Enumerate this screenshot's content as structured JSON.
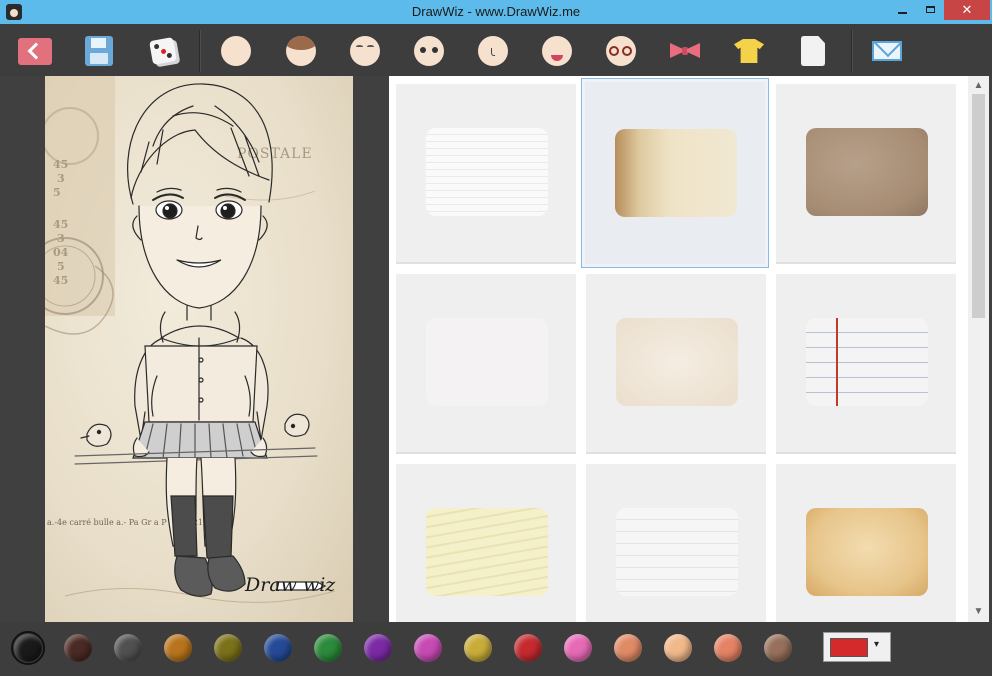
{
  "window": {
    "title": "DrawWiz - www.DrawWiz.me",
    "minimize_icon": "minimize-icon",
    "maximize_icon": "maximize-icon",
    "close_icon": "close-icon",
    "close_glyph": "✕"
  },
  "toolbar": {
    "buttons": [
      {
        "name": "back",
        "icon": "back-arrow-icon"
      },
      {
        "name": "save",
        "icon": "floppy-disk-icon"
      },
      {
        "name": "random",
        "icon": "dice-icon"
      },
      {
        "name": "face-shape",
        "icon": "face-icon"
      },
      {
        "name": "hair",
        "icon": "hair-icon"
      },
      {
        "name": "eyebrows",
        "icon": "eyebrows-icon"
      },
      {
        "name": "eyes",
        "icon": "eyes-icon"
      },
      {
        "name": "nose",
        "icon": "nose-icon"
      },
      {
        "name": "mouth",
        "icon": "mouth-icon"
      },
      {
        "name": "glasses",
        "icon": "glasses-icon"
      },
      {
        "name": "accessories",
        "icon": "bow-icon"
      },
      {
        "name": "clothes",
        "icon": "shirt-icon"
      },
      {
        "name": "background",
        "icon": "paper-icon",
        "active": true
      },
      {
        "name": "share",
        "icon": "envelope-icon"
      }
    ]
  },
  "canvas": {
    "stamp_text": "POSTALE",
    "postmark_lines": [
      "45",
      "3",
      "5",
      "45",
      "3",
      "04",
      "5",
      "45"
    ],
    "bottom_text": "a.-4e carré bulle  a.- Pa Gr a P (30-5-21)",
    "watermark": "Draw wiz"
  },
  "backgrounds": {
    "selected_index": 1,
    "items": [
      {
        "name": "white-lined-paper"
      },
      {
        "name": "postal-card-paper"
      },
      {
        "name": "kraft-paper"
      },
      {
        "name": "blank-white-paper"
      },
      {
        "name": "cream-paper"
      },
      {
        "name": "notebook-paper"
      },
      {
        "name": "wrinkled-yellow-paper"
      },
      {
        "name": "white-brick-texture"
      },
      {
        "name": "aged-parchment-paper"
      }
    ]
  },
  "scrollbar": {
    "up_glyph": "▲",
    "down_glyph": "▼"
  },
  "palette": {
    "colors": [
      "#1a1a1a",
      "#4a2a24",
      "#505050",
      "#b8741c",
      "#7a7118",
      "#254a96",
      "#2b8a3c",
      "#7a2aa4",
      "#c64ab4",
      "#c8ac3a",
      "#c42a30",
      "#e66ab6",
      "#e08a66",
      "#f1b88a",
      "#e48264",
      "#96705a"
    ],
    "selected_index": 0,
    "current_color": "#d42a2c",
    "dropdown_caret": "▾"
  }
}
